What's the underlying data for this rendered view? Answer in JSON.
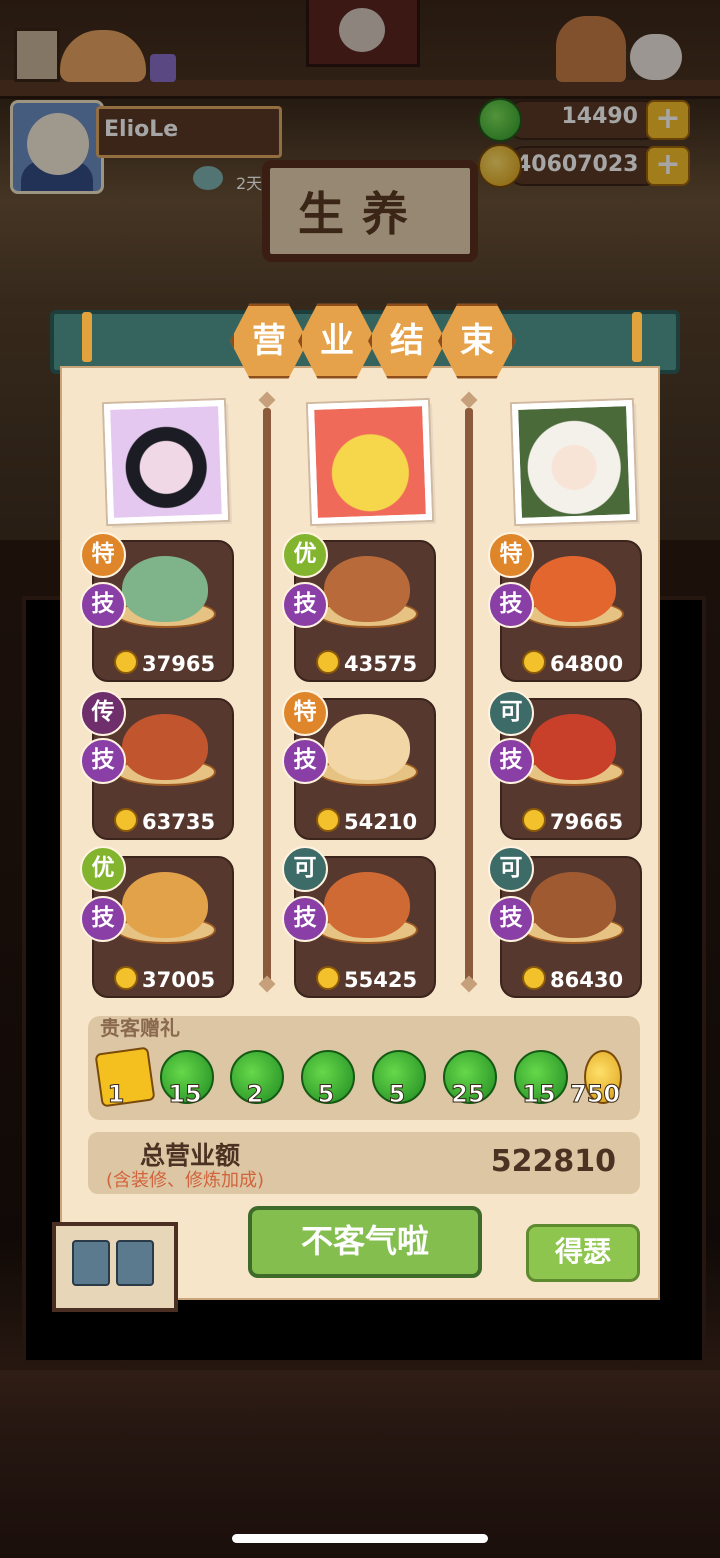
{
  "player": {
    "name": "ElioLe",
    "days": "2天"
  },
  "currency": {
    "jade": "14490",
    "coins": "40607023",
    "plus_label": "+"
  },
  "shop_sign": "生养",
  "title_chars": [
    "营",
    "业",
    "结",
    "束"
  ],
  "columns": [
    {
      "portrait": "kuromi-party-portrait",
      "dishes": [
        {
          "grade": "特",
          "skill": "技",
          "price": "37965",
          "dish_icon": "hotpot-icon"
        },
        {
          "grade": "传",
          "skill": "技",
          "price": "63735",
          "dish_icon": "crab-bowl-icon"
        },
        {
          "grade": "优",
          "skill": "技",
          "price": "37005",
          "dish_icon": "burger-platter-icon"
        }
      ]
    },
    {
      "portrait": "chick-portrait",
      "dishes": [
        {
          "grade": "优",
          "skill": "技",
          "price": "43575",
          "dish_icon": "clay-pot-icon"
        },
        {
          "grade": "特",
          "skill": "技",
          "price": "54210",
          "dish_icon": "steamed-bun-icon"
        },
        {
          "grade": "可",
          "skill": "技",
          "price": "55425",
          "dish_icon": "noodle-crab-icon"
        }
      ]
    },
    {
      "portrait": "white-hair-girl-portrait",
      "dishes": [
        {
          "grade": "特",
          "skill": "技",
          "price": "64800",
          "dish_icon": "shrimp-plate-icon"
        },
        {
          "grade": "可",
          "skill": "技",
          "price": "79665",
          "dish_icon": "lobster-bowl-icon"
        },
        {
          "grade": "可",
          "skill": "技",
          "price": "86430",
          "dish_icon": "stew-pot-icon"
        }
      ]
    }
  ],
  "gifts": {
    "title": "贵客赠礼",
    "items": [
      {
        "icon": "ticket-icon",
        "count": "1"
      },
      {
        "icon": "jade-icon",
        "count": "15"
      },
      {
        "icon": "jade-icon",
        "count": "2"
      },
      {
        "icon": "jade-icon",
        "count": "5"
      },
      {
        "icon": "jade-icon",
        "count": "5"
      },
      {
        "icon": "jade-icon",
        "count": "25"
      },
      {
        "icon": "jade-icon",
        "count": "15"
      },
      {
        "icon": "coin-icon",
        "count": "750"
      }
    ]
  },
  "total": {
    "label": "总营业额",
    "sub": "(含装修、修炼加成)",
    "value": "522810"
  },
  "buttons": {
    "main": "不客气啦",
    "side": "得瑟"
  },
  "colors": {
    "panel": "#f6e5c9",
    "card": "#56382e",
    "button_green": "#83be4e",
    "banner": "#35645f"
  }
}
